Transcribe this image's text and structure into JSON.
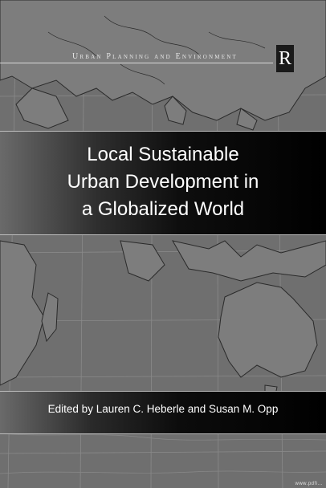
{
  "series": {
    "label": "Urban Planning and Environment"
  },
  "publisher": {
    "logo_letter": "R"
  },
  "book": {
    "title_lines": [
      "Local Sustainable",
      "Urban Development in",
      "a Globalized World"
    ],
    "editors": "Edited by Lauren C. Heberle and Susan M. Opp"
  },
  "corner": {
    "text": "www.pdfi..."
  },
  "colors": {
    "background": "#6e6e6e",
    "band": "#000000",
    "text": "#ffffff"
  },
  "icons": {
    "publisher_logo": "routledge-logo-icon",
    "background": "world-map-icon"
  }
}
